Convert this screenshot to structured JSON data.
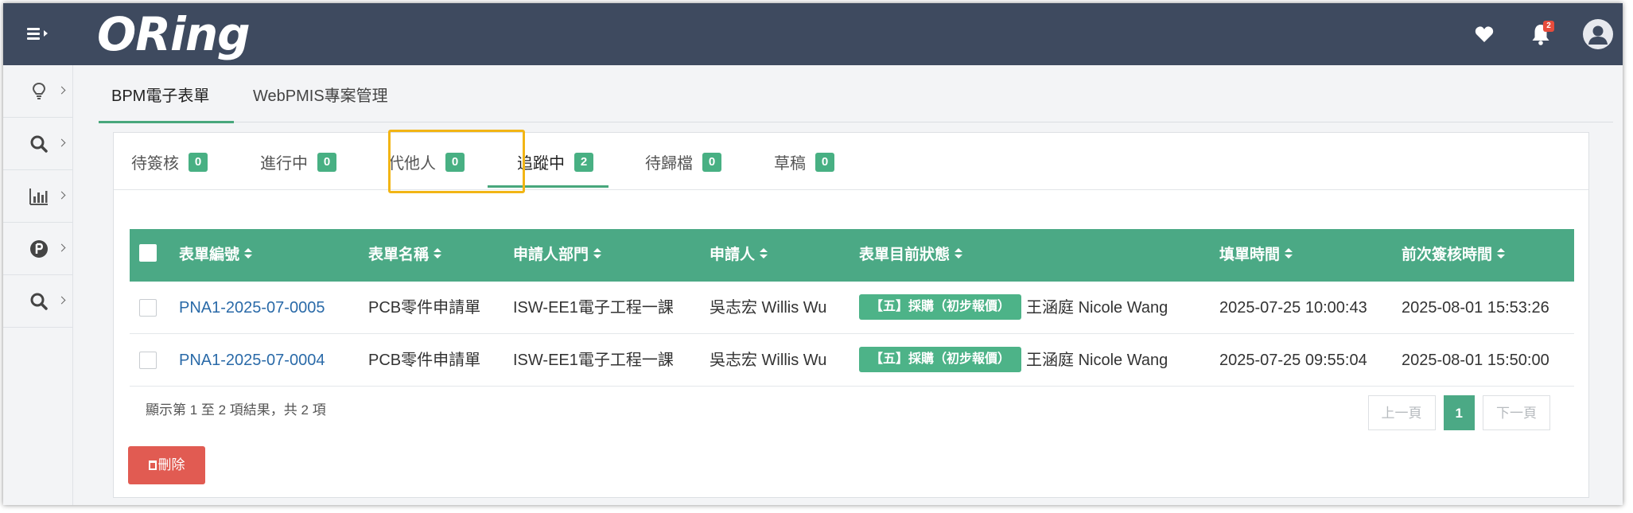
{
  "header": {
    "logo_text": "ORing",
    "notification_count": "2",
    "icons": [
      "menu-icon",
      "heart-icon",
      "bell-icon",
      "user-avatar-icon"
    ]
  },
  "sidebar": {
    "items": [
      {
        "icon": "lightbulb-icon"
      },
      {
        "icon": "search-icon"
      },
      {
        "icon": "bar-chart-icon"
      },
      {
        "icon": "p-circle-icon"
      },
      {
        "icon": "search-icon"
      }
    ]
  },
  "main_tabs": [
    {
      "label": "BPM電子表單",
      "active": true
    },
    {
      "label": "WebPMIS專案管理",
      "active": false
    }
  ],
  "sub_tabs": [
    {
      "label": "待簽核",
      "count": "0"
    },
    {
      "label": "進行中",
      "count": "0"
    },
    {
      "label": "代他人",
      "count": "0"
    },
    {
      "label": "追蹤中",
      "count": "2",
      "active": true
    },
    {
      "label": "待歸檔",
      "count": "0"
    },
    {
      "label": "草稿",
      "count": "0"
    }
  ],
  "table": {
    "columns": [
      "表單編號",
      "表單名稱",
      "申請人部門",
      "申請人",
      "表單目前狀態",
      "填單時間",
      "前次簽核時間"
    ],
    "rows": [
      {
        "id": "PNA1-2025-07-0005",
        "name": "PCB零件申請單",
        "dept": "ISW-EE1電子工程一課",
        "applicant": "吳志宏 Willis Wu",
        "status_tag": "【五】採購（初步報價）",
        "status_person": "王涵庭 Nicole Wang",
        "filled": "2025-07-25 10:00:43",
        "last_signed": "2025-08-01 15:53:26"
      },
      {
        "id": "PNA1-2025-07-0004",
        "name": "PCB零件申請單",
        "dept": "ISW-EE1電子工程一課",
        "applicant": "吳志宏 Willis Wu",
        "status_tag": "【五】採購（初步報價）",
        "status_person": "王涵庭 Nicole Wang",
        "filled": "2025-07-25 09:55:04",
        "last_signed": "2025-08-01 15:50:00"
      }
    ]
  },
  "footer": {
    "info": "顯示第 1 至 2 項結果，共 2 項",
    "prev": "上一頁",
    "current_page": "1",
    "next": "下一頁",
    "delete_label": "刪除"
  },
  "colors": {
    "topbar": "#3e4a5f",
    "accent_green": "#4ba985",
    "delete_red": "#e15b52",
    "highlight": "#f2b515"
  }
}
